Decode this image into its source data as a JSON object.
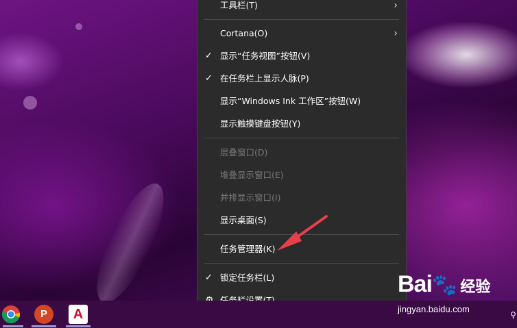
{
  "context_menu": {
    "items": [
      {
        "label": "工具栏(T)",
        "submenu": true
      },
      {
        "label": "Cortana(O)",
        "submenu": true
      },
      {
        "label": "显示“任务视图”按钮(V)",
        "checked": true
      },
      {
        "label": "在任务栏上显示人脉(P)",
        "checked": true
      },
      {
        "label": "显示“Windows Ink 工作区”按钮(W)"
      },
      {
        "label": "显示触摸键盘按钮(Y)"
      },
      {
        "label": "层叠窗口(D)",
        "disabled": true
      },
      {
        "label": "堆叠显示窗口(E)",
        "disabled": true
      },
      {
        "label": "并排显示窗口(I)",
        "disabled": true
      },
      {
        "label": "显示桌面(S)"
      },
      {
        "label": "任务管理器(K)"
      },
      {
        "label": "锁定任务栏(L)",
        "checked": true
      },
      {
        "label": "任务栏设置(T)",
        "icon": "gear-icon"
      }
    ],
    "check_glyph": "✓",
    "submenu_glyph": "›",
    "gear_glyph": "⚙"
  },
  "taskbar": {
    "apps": [
      {
        "name": "chrome-icon"
      },
      {
        "name": "powerpoint-icon",
        "letter": "P"
      },
      {
        "name": "autocad-icon",
        "letter": "A"
      }
    ]
  },
  "watermark": {
    "brand": "Bai",
    "brand_suffix": "经验",
    "url": "jingyan.baidu.com"
  },
  "annotation_color": "#e8404a"
}
